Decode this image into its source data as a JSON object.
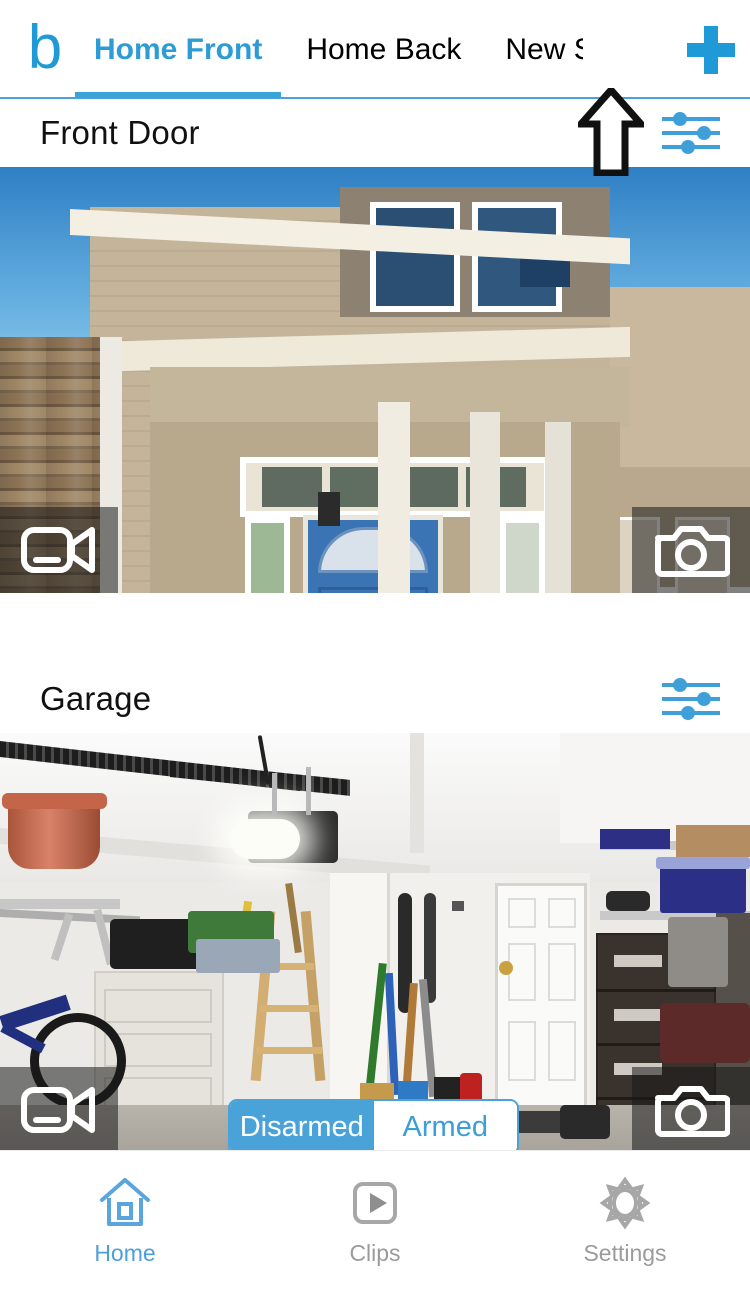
{
  "app": {
    "brand_logo_letter": "b",
    "brand_color": "#1f9ad6",
    "accent_color": "#4aa3d8"
  },
  "tabs": {
    "items": [
      {
        "label": "Home Front",
        "active": true
      },
      {
        "label": "Home Back",
        "active": false
      },
      {
        "label": "New Sy",
        "active": false
      }
    ],
    "add_button": {
      "icon": "plus-icon",
      "label": "+"
    }
  },
  "annotation": {
    "type": "up-arrow",
    "color": "#111111",
    "points_at": "New Sy"
  },
  "cameras": [
    {
      "name": "Front Door",
      "settings_icon": "sliders-icon",
      "overlay_left_icon": "video-camera-icon",
      "overlay_right_icon": "photo-camera-icon",
      "scene": "front-door-house"
    },
    {
      "name": "Garage",
      "settings_icon": "sliders-icon",
      "overlay_left_icon": "video-camera-icon",
      "overlay_right_icon": "photo-camera-icon",
      "scene": "garage-interior",
      "arm_toggle": {
        "options": [
          "Disarmed",
          "Armed"
        ],
        "selected": "Disarmed",
        "disarmed_label": "Disarmed",
        "armed_label": "Armed"
      }
    }
  ],
  "bottom_nav": {
    "items": [
      {
        "label": "Home",
        "icon": "house-icon",
        "active": true
      },
      {
        "label": "Clips",
        "icon": "play-square-icon",
        "active": false
      },
      {
        "label": "Settings",
        "icon": "gear-icon",
        "active": false
      }
    ]
  }
}
